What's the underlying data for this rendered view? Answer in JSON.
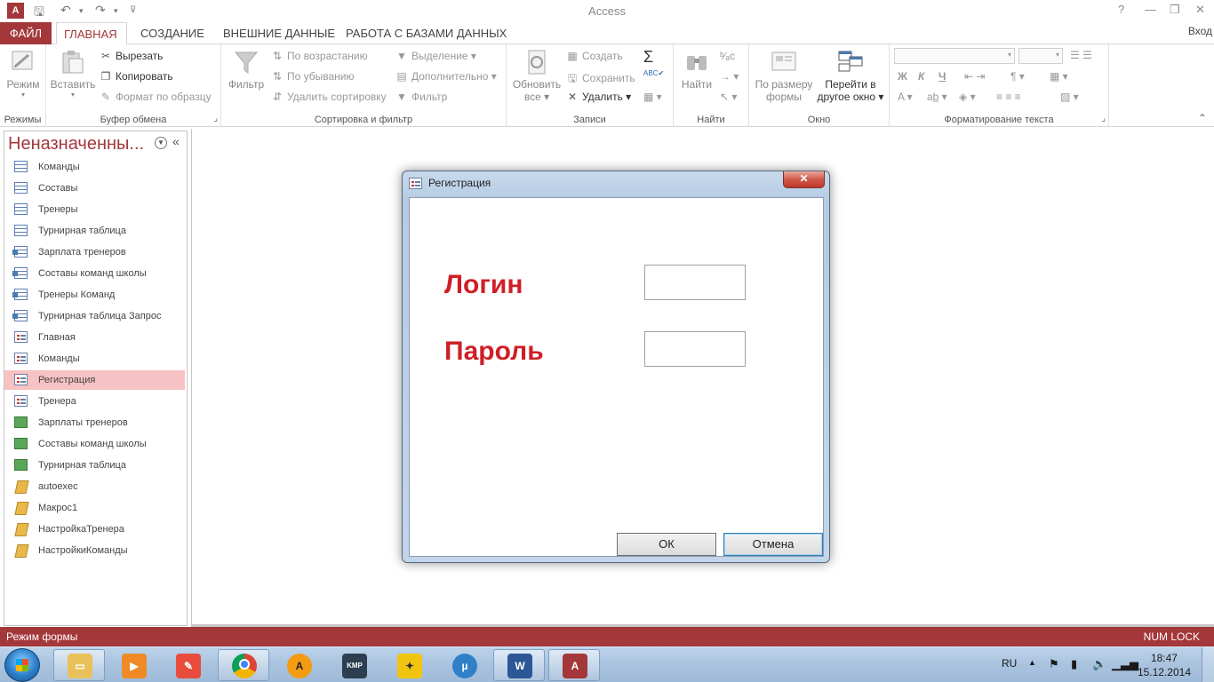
{
  "titlebar": {
    "app_icon": "A",
    "title": "Access",
    "help": "?",
    "minimize": "—",
    "restore": "❐",
    "close": "✕"
  },
  "tabs": {
    "file": "ФАЙЛ",
    "home": "ГЛАВНАЯ",
    "create": "СОЗДАНИЕ",
    "external": "ВНЕШНИЕ ДАННЫЕ",
    "database": "РАБОТА С БАЗАМИ ДАННЫХ",
    "signin": "Вход"
  },
  "ribbon": {
    "views": {
      "mode": "Режим",
      "label": "Режимы"
    },
    "clipboard": {
      "paste": "Вставить",
      "cut": "Вырезать",
      "copy": "Копировать",
      "format_painter": "Формат по образцу",
      "label": "Буфер обмена"
    },
    "sort": {
      "filter": "Фильтр",
      "ascending": "По возрастанию",
      "descending": "По убыванию",
      "remove_sort": "Удалить сортировку",
      "selection": "Выделение",
      "advanced": "Дополнительно",
      "toggle_filter": "Фильтр",
      "label": "Сортировка и фильтр"
    },
    "records": {
      "refresh_line1": "Обновить",
      "refresh_line2": "все",
      "new": "Создать",
      "save": "Сохранить",
      "delete": "Удалить",
      "label": "Записи"
    },
    "find": {
      "find": "Найти",
      "label": "Найти"
    },
    "window": {
      "size_line1": "По размеру",
      "size_line2": "формы",
      "switch_line1": "Перейти в",
      "switch_line2": "другое окно",
      "label": "Окно"
    },
    "text_format": {
      "bold": "Ж",
      "italic": "К",
      "underline": "Ч",
      "label": "Форматирование текста"
    }
  },
  "navpane": {
    "title": "Неназначенны...",
    "items": [
      {
        "label": "Команды",
        "kind": "table"
      },
      {
        "label": "Составы",
        "kind": "table"
      },
      {
        "label": "Тренеры",
        "kind": "table"
      },
      {
        "label": "Турнирная таблица",
        "kind": "table"
      },
      {
        "label": "Зарплата тренеров",
        "kind": "query"
      },
      {
        "label": "Составы команд школы",
        "kind": "query"
      },
      {
        "label": "Тренеры Команд",
        "kind": "query"
      },
      {
        "label": "Турнирная таблица Запрос",
        "kind": "query"
      },
      {
        "label": "Главная",
        "kind": "form"
      },
      {
        "label": "Команды",
        "kind": "form"
      },
      {
        "label": "Регистрация",
        "kind": "form",
        "selected": true
      },
      {
        "label": "Тренера",
        "kind": "form"
      },
      {
        "label": "Зарплаты тренеров",
        "kind": "report"
      },
      {
        "label": "Составы команд школы",
        "kind": "report"
      },
      {
        "label": "Турнирная таблица",
        "kind": "report"
      },
      {
        "label": "autoexec",
        "kind": "macro"
      },
      {
        "label": "Макрос1",
        "kind": "macro"
      },
      {
        "label": "НастройкаТренера",
        "kind": "macro"
      },
      {
        "label": "НастройкиКоманды",
        "kind": "macro"
      }
    ]
  },
  "dialog": {
    "title": "Регистрация",
    "login_label": "Логин",
    "password_label": "Пароль",
    "login_value": "",
    "password_value": "",
    "ok": "ОК",
    "cancel": "Отмена",
    "close": "✕"
  },
  "statusbar": {
    "left": "Режим формы",
    "right": "NUM LOCK"
  },
  "taskbar": {
    "apps": [
      "explorer",
      "media-player",
      "paint",
      "chrome",
      "aimp",
      "kmplayer",
      "games",
      "utorrent",
      "word",
      "access"
    ],
    "lang": "RU",
    "time": "18:47",
    "date": "15.12.2014"
  },
  "colors": {
    "accent": "#a4373a",
    "label_red": "#cf1f26",
    "selected_nav": "#f7c2c3"
  }
}
